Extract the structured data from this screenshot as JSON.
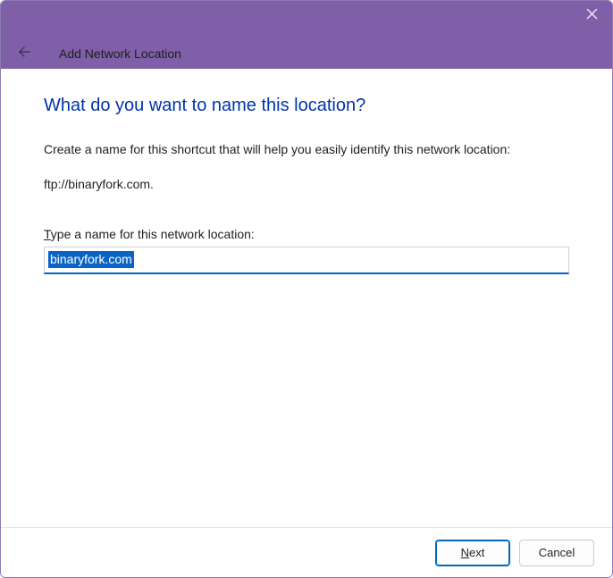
{
  "titlebar": {
    "close_icon": "close"
  },
  "header": {
    "back_icon": "back-arrow",
    "title": "Add Network Location"
  },
  "main": {
    "heading": "What do you want to name this location?",
    "description": "Create a name for this shortcut that will help you easily identify this network location:",
    "address": "ftp://binaryfork.com.",
    "input_label_prefix_accel": "T",
    "input_label_rest": "ype a name for this network location:",
    "input_value": "binaryfork.com"
  },
  "footer": {
    "next_accel": "N",
    "next_rest": "ext",
    "cancel_label": "Cancel"
  }
}
